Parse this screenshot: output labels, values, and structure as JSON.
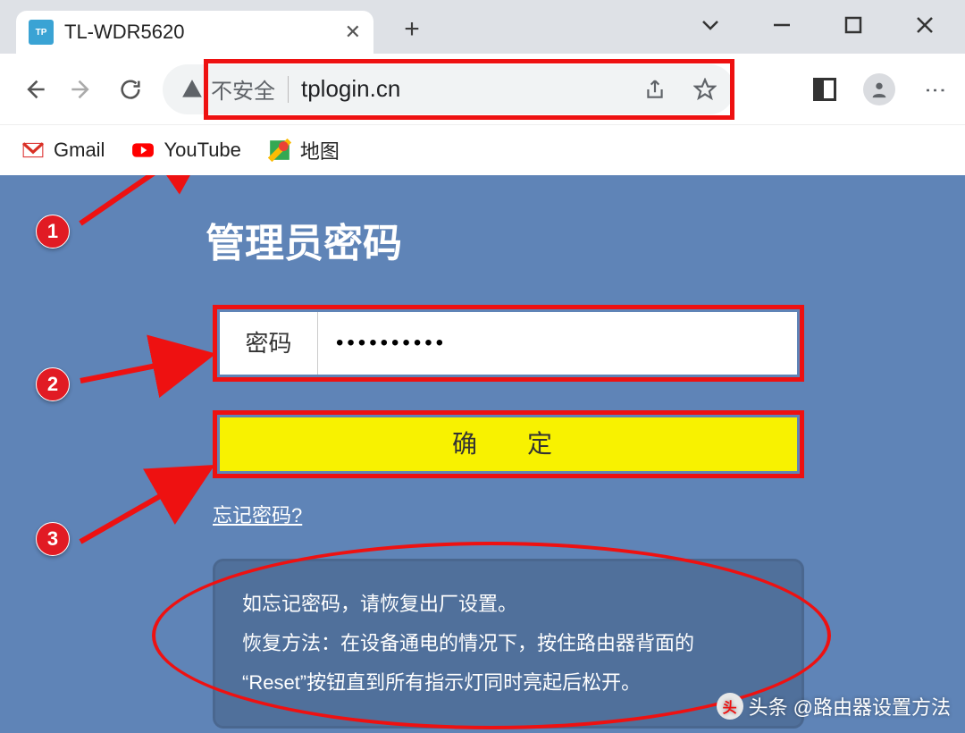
{
  "window": {
    "tab_title": "TL-WDR5620",
    "favicon_text": "TP"
  },
  "toolbar": {
    "insecure_label": "不安全",
    "url": "tplogin.cn"
  },
  "bookmarks": {
    "gmail": "Gmail",
    "youtube": "YouTube",
    "maps": "地图"
  },
  "page": {
    "title": "管理员密码",
    "password_label": "密码",
    "password_value": "••••••••••",
    "submit_label": "确　定",
    "forgot_label": "忘记密码?",
    "info_line1": "如忘记密码，请恢复出厂设置。",
    "info_line2": "恢复方法：在设备通电的情况下，按住路由器背面的",
    "info_line3": "“Reset”按钮直到所有指示灯同时亮起后松开。"
  },
  "annotations": {
    "badge1": "1",
    "badge2": "2",
    "badge3": "3"
  },
  "watermark": {
    "prefix": "头条",
    "text": "@路由器设置方法"
  }
}
